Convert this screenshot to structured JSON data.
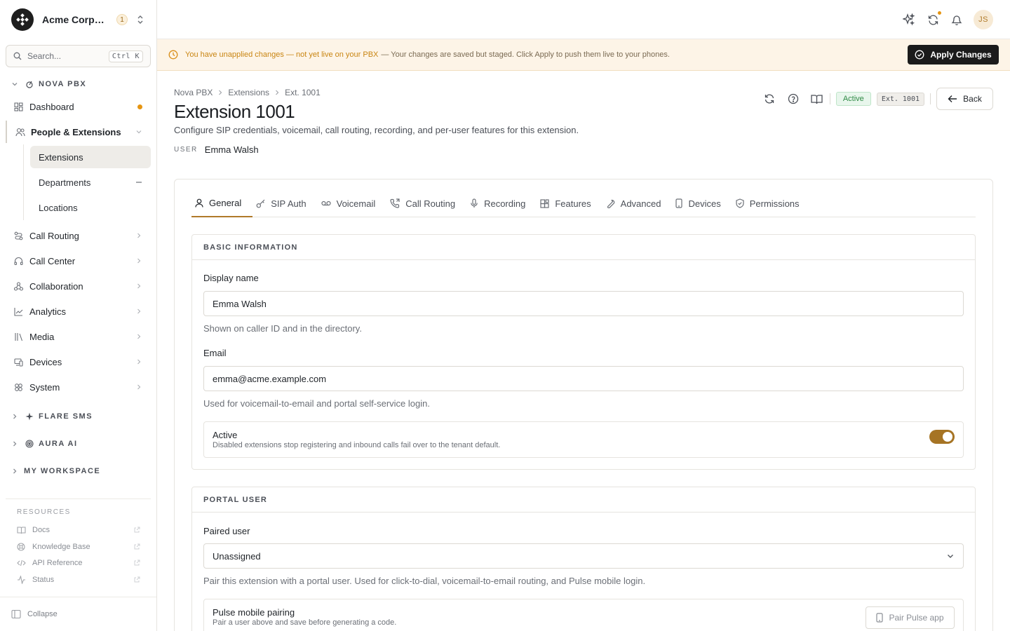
{
  "org": {
    "name": "Acme Corporation",
    "badge": "1"
  },
  "search": {
    "placeholder": "Search...",
    "shortcut": "Ctrl K"
  },
  "sidebar": {
    "sections": [
      {
        "label": "NOVA PBX",
        "icon": "router-icon",
        "expanded": true
      },
      {
        "label": "FLARE SMS",
        "icon": "sparkle-icon",
        "expanded": false
      },
      {
        "label": "AURA AI",
        "icon": "target-icon",
        "expanded": false
      },
      {
        "label": "MY WORKSPACE",
        "icon": "",
        "expanded": false
      }
    ],
    "items": [
      {
        "label": "Dashboard",
        "icon": "dashboard-icon"
      },
      {
        "label": "People & Extensions",
        "icon": "users-icon"
      },
      {
        "label": "Call Routing",
        "icon": "routing-icon"
      },
      {
        "label": "Call Center",
        "icon": "headset-icon"
      },
      {
        "label": "Collaboration",
        "icon": "collaboration-icon"
      },
      {
        "label": "Analytics",
        "icon": "chart-icon"
      },
      {
        "label": "Media",
        "icon": "library-icon"
      },
      {
        "label": "Devices",
        "icon": "devices-icon"
      },
      {
        "label": "System",
        "icon": "system-icon"
      }
    ],
    "sub_items": [
      {
        "label": "Extensions",
        "selected": true
      },
      {
        "label": "Departments",
        "selected": false
      },
      {
        "label": "Locations",
        "selected": false
      }
    ],
    "resources_title": "RESOURCES",
    "resources": [
      {
        "label": "Docs",
        "icon": "book-icon"
      },
      {
        "label": "Knowledge Base",
        "icon": "lifebuoy-icon"
      },
      {
        "label": "API Reference",
        "icon": "code-icon"
      },
      {
        "label": "Status",
        "icon": "activity-icon"
      }
    ],
    "collapse_label": "Collapse"
  },
  "topbar": {
    "avatar_initials": "JS"
  },
  "banner": {
    "strong": "You have unapplied changes — not yet live on your PBX",
    "text": "— Your changes are saved but staged. Click Apply to push them live to your phones.",
    "button": "Apply Changes"
  },
  "page": {
    "breadcrumb": [
      "Nova PBX",
      "Extensions",
      "Ext. 1001"
    ],
    "title": "Extension 1001",
    "description": "Configure SIP credentials, voicemail, call routing, recording, and per-user features for this extension.",
    "user_label": "USER",
    "user_value": "Emma Walsh",
    "status_pill": "Active",
    "ext_pill": "Ext. 1001",
    "back_label": "Back"
  },
  "tabs": [
    {
      "label": "General",
      "icon": "user-icon",
      "active": true
    },
    {
      "label": "SIP Auth",
      "icon": "key-icon",
      "active": false
    },
    {
      "label": "Voicemail",
      "icon": "voicemail-icon",
      "active": false
    },
    {
      "label": "Call Routing",
      "icon": "phone-forward-icon",
      "active": false
    },
    {
      "label": "Recording",
      "icon": "mic-icon",
      "active": false
    },
    {
      "label": "Features",
      "icon": "blocks-icon",
      "active": false
    },
    {
      "label": "Advanced",
      "icon": "wrench-icon",
      "active": false
    },
    {
      "label": "Devices",
      "icon": "smartphone-icon",
      "active": false
    },
    {
      "label": "Permissions",
      "icon": "shield-icon",
      "active": false
    }
  ],
  "basic": {
    "title": "BASIC INFORMATION",
    "display_name_label": "Display name",
    "display_name_value": "Emma Walsh",
    "display_name_help": "Shown on caller ID and in the directory.",
    "email_label": "Email",
    "email_value": "emma@acme.example.com",
    "email_help": "Used for voicemail-to-email and portal self-service login.",
    "active_title": "Active",
    "active_desc": "Disabled extensions stop registering and inbound calls fail over to the tenant default.",
    "active_on": true
  },
  "portal": {
    "title": "PORTAL USER",
    "paired_label": "Paired user",
    "paired_value": "Unassigned",
    "paired_help": "Pair this extension with a portal user. Used for click-to-dial, voicemail-to-email routing, and Pulse mobile login.",
    "pulse_title": "Pulse mobile pairing",
    "pulse_desc": "Pair a user above and save before generating a code.",
    "pulse_button": "Pair Pulse app"
  },
  "colors": {
    "accent": "#a67424",
    "banner_bg": "#fdf4e7",
    "banner_text": "#c98512",
    "active_green": "#2f8a45",
    "notify": "#e69512"
  }
}
